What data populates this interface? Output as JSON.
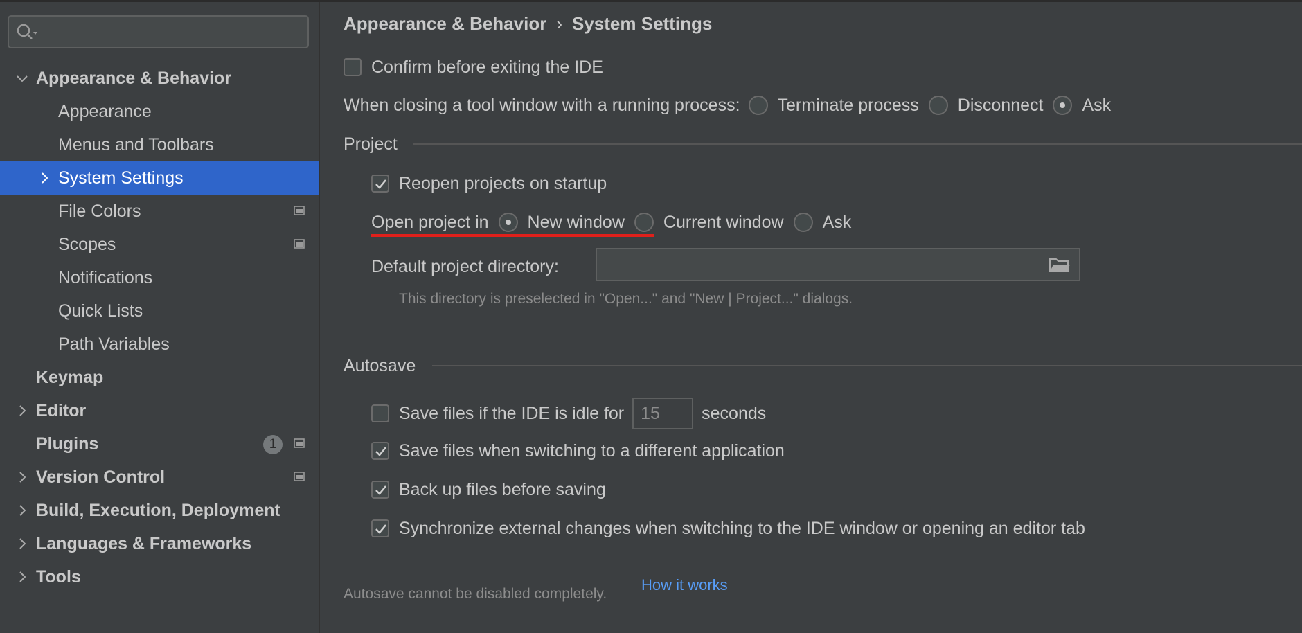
{
  "search": {
    "placeholder": "",
    "value": ""
  },
  "sidebar": {
    "items": [
      {
        "label": "Appearance & Behavior"
      },
      {
        "label": "Appearance"
      },
      {
        "label": "Menus and Toolbars"
      },
      {
        "label": "System Settings"
      },
      {
        "label": "File Colors"
      },
      {
        "label": "Scopes"
      },
      {
        "label": "Notifications"
      },
      {
        "label": "Quick Lists"
      },
      {
        "label": "Path Variables"
      },
      {
        "label": "Keymap"
      },
      {
        "label": "Editor"
      },
      {
        "label": "Plugins",
        "badge": "1"
      },
      {
        "label": "Version Control"
      },
      {
        "label": "Build, Execution, Deployment"
      },
      {
        "label": "Languages & Frameworks"
      },
      {
        "label": "Tools"
      }
    ]
  },
  "breadcrumb": {
    "parent": "Appearance & Behavior",
    "separator": "›",
    "current": "System Settings"
  },
  "general": {
    "confirm_exit": {
      "label": "Confirm before exiting the IDE",
      "checked": false
    },
    "tool_window": {
      "label": "When closing a tool window with a running process:",
      "options": [
        "Terminate process",
        "Disconnect",
        "Ask"
      ],
      "selected": "Ask"
    }
  },
  "project": {
    "title": "Project",
    "reopen": {
      "label": "Reopen projects on startup",
      "checked": true
    },
    "open_in": {
      "label": "Open project in",
      "options": [
        "New window",
        "Current window",
        "Ask"
      ],
      "selected": "New window"
    },
    "default_dir": {
      "label": "Default project directory:",
      "value": ""
    },
    "hint": "This directory is preselected in \"Open...\" and \"New | Project...\" dialogs."
  },
  "autosave": {
    "title": "Autosave",
    "idle": {
      "label": "Save files if the IDE is idle for",
      "value": "15",
      "unit": "seconds",
      "checked": false
    },
    "switch_app": {
      "label": "Save files when switching to a different application",
      "checked": true
    },
    "backup": {
      "label": "Back up files before saving",
      "checked": true
    },
    "sync": {
      "label": "Synchronize external changes when switching to the IDE window or opening an editor tab",
      "checked": true
    },
    "note": "Autosave cannot be disabled completely.",
    "link": "How it works"
  },
  "colors": {
    "selection": "#2f65ca",
    "background": "#3c3f41",
    "link": "#589df6",
    "highlight": "#e0201b"
  }
}
